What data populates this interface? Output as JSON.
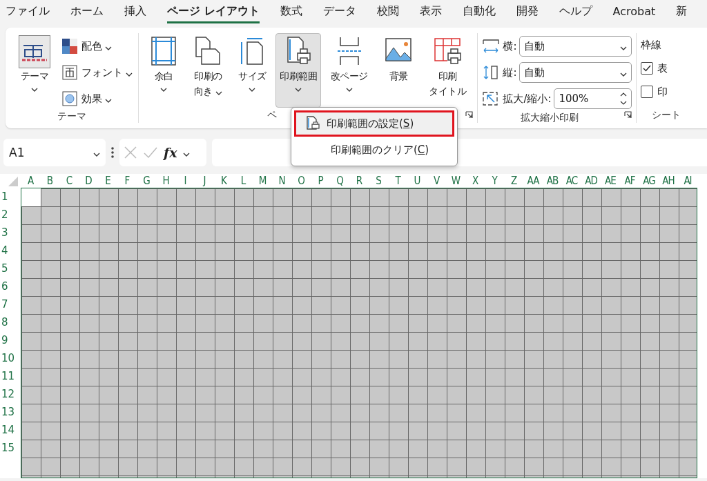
{
  "tabs": [
    {
      "label": "ファイル",
      "selected": false
    },
    {
      "label": "ホーム",
      "selected": false
    },
    {
      "label": "挿入",
      "selected": false
    },
    {
      "label": "ページ レイアウト",
      "selected": true
    },
    {
      "label": "数式",
      "selected": false
    },
    {
      "label": "データ",
      "selected": false
    },
    {
      "label": "校閲",
      "selected": false
    },
    {
      "label": "表示",
      "selected": false
    },
    {
      "label": "自動化",
      "selected": false
    },
    {
      "label": "開発",
      "selected": false
    },
    {
      "label": "ヘルプ",
      "selected": false
    },
    {
      "label": "Acrobat",
      "selected": false
    },
    {
      "label": "新",
      "selected": false
    }
  ],
  "theme_group": {
    "label": "テーマ",
    "big_button": "テーマ",
    "small_buttons": [
      "配色",
      "フォント",
      "効果"
    ]
  },
  "page_setup_group": {
    "label": "ペ",
    "buttons": [
      {
        "lines": [
          "余白"
        ],
        "dropdown": true,
        "pressed": false
      },
      {
        "lines": [
          "印刷の",
          "向き"
        ],
        "dropdown": true,
        "pressed": false
      },
      {
        "lines": [
          "サイズ"
        ],
        "dropdown": true,
        "pressed": false
      },
      {
        "lines": [
          "印刷範囲"
        ],
        "dropdown": true,
        "pressed": true
      },
      {
        "lines": [
          "改ページ"
        ],
        "dropdown": true,
        "pressed": false
      },
      {
        "lines": [
          "背景"
        ],
        "dropdown": false,
        "pressed": false
      },
      {
        "lines": [
          "印刷",
          "タイトル"
        ],
        "dropdown": false,
        "pressed": false
      }
    ]
  },
  "scale_group": {
    "label": "拡大縮小印刷",
    "fields": [
      {
        "kind": "select",
        "label": "横:",
        "value": "自動"
      },
      {
        "kind": "select",
        "label": "縦:",
        "value": "自動"
      },
      {
        "kind": "spin",
        "label": "拡大/縮小:",
        "value": "100%"
      }
    ]
  },
  "sheet_group": {
    "label": "シート",
    "heading": "枠線",
    "options": [
      {
        "label": "表",
        "checked": true
      },
      {
        "label": "印",
        "checked": false
      }
    ]
  },
  "menu": {
    "items": [
      {
        "before": "印刷範囲の設定(",
        "key": "S",
        "after": ")",
        "icon": true,
        "highlighted": true
      },
      {
        "before": "印刷範囲のクリア(",
        "key": "C",
        "after": ")",
        "icon": false,
        "highlighted": false
      }
    ]
  },
  "formula_bar": {
    "name_box": "A1",
    "function_label": "fx"
  },
  "sheet": {
    "columns": [
      "A",
      "B",
      "C",
      "D",
      "E",
      "F",
      "G",
      "H",
      "I",
      "J",
      "K",
      "L",
      "M",
      "N",
      "O",
      "P",
      "Q",
      "R",
      "S",
      "T",
      "U",
      "V",
      "W",
      "X",
      "Y",
      "Z",
      "AA",
      "AB",
      "AC",
      "AD",
      "AE",
      "AF",
      "AG",
      "AH",
      "AI"
    ],
    "rows": [
      "1",
      "2",
      "3",
      "4",
      "5",
      "6",
      "7",
      "8",
      "9",
      "10",
      "11",
      "12",
      "13",
      "14",
      "15"
    ]
  }
}
